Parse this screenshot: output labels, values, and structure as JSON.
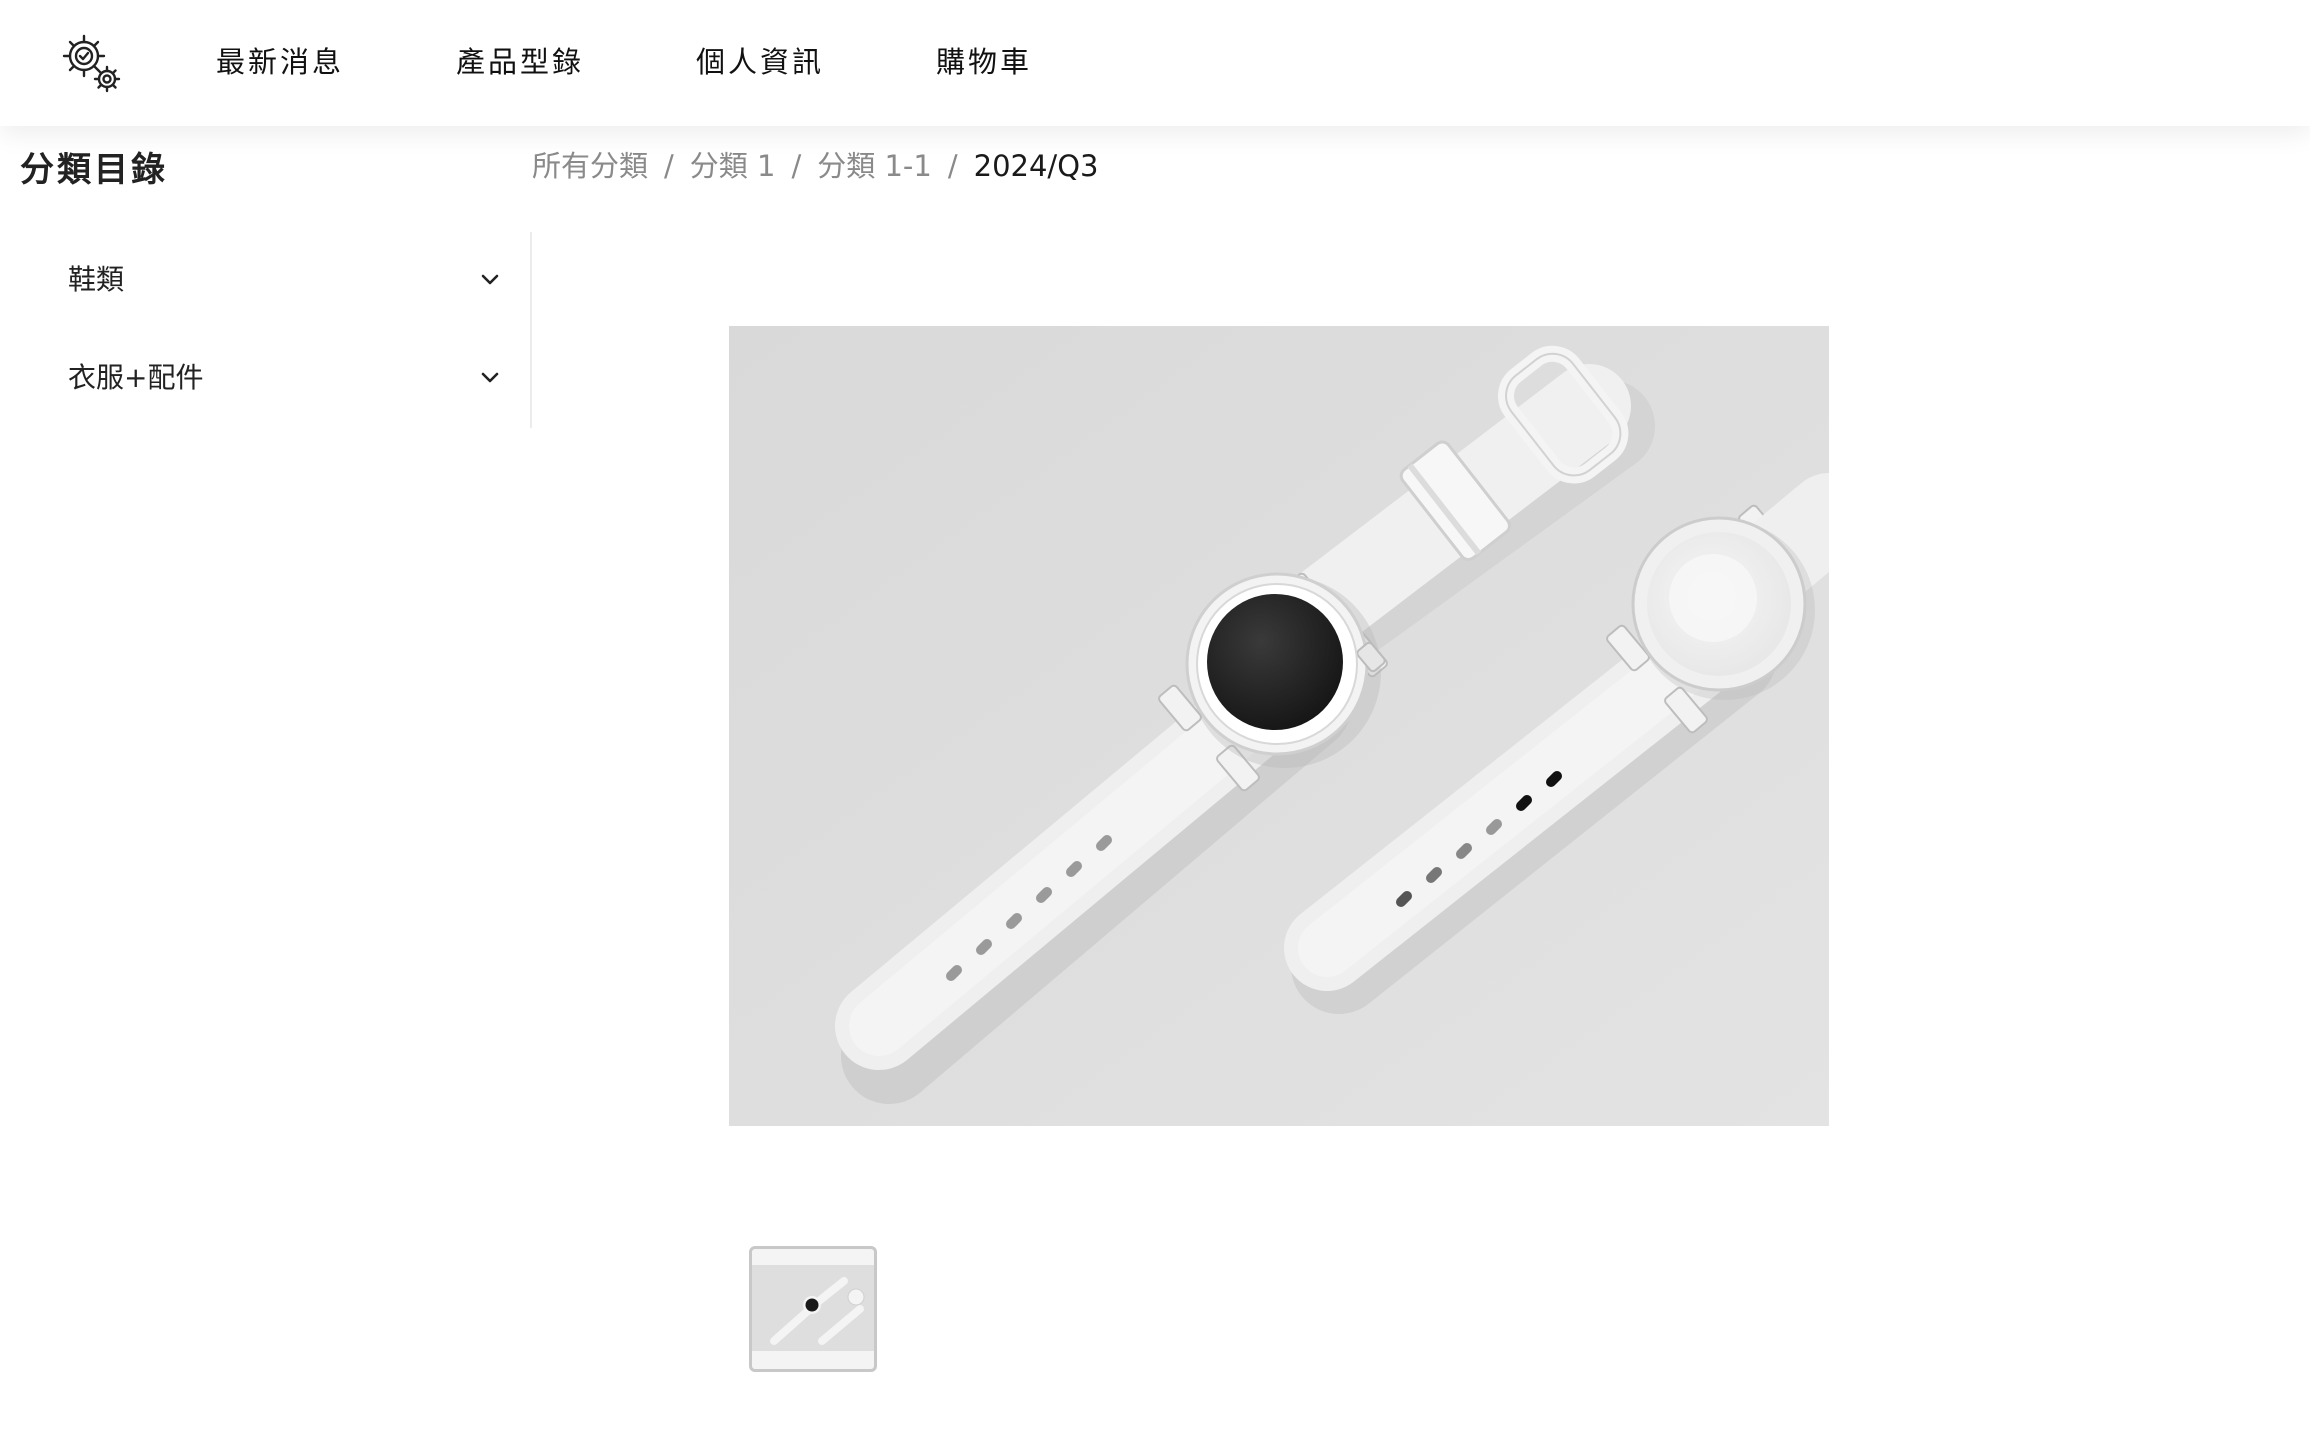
{
  "header": {
    "logo_icon": "gear-check-icon",
    "nav": [
      {
        "label": "最新消息"
      },
      {
        "label": "產品型錄"
      },
      {
        "label": "個人資訊"
      },
      {
        "label": "購物車"
      }
    ]
  },
  "sidebar": {
    "title": "分類目錄",
    "categories": [
      {
        "label": "鞋類",
        "icon": "chevron-down-icon"
      },
      {
        "label": "衣服+配件",
        "icon": "chevron-down-icon"
      }
    ]
  },
  "breadcrumb": {
    "items": [
      "所有分類",
      "分類 1",
      "分類 1-1",
      "2024/Q3"
    ],
    "separator": "/"
  },
  "gallery": {
    "main_image": "white-smartwatch-pair-photo",
    "thumbnails": [
      "white-smartwatch-pair-photo"
    ]
  },
  "colors": {
    "text": "#1a1a1a",
    "breadcrumb_muted": "#8a8a8a",
    "image_background": "#dedede",
    "thumbnail_border": "#c8c8c8"
  }
}
